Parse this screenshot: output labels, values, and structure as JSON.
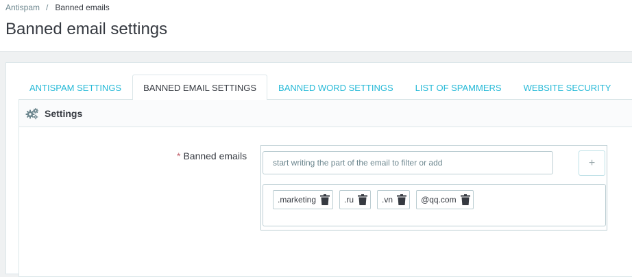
{
  "breadcrumb": {
    "parent": "Antispam",
    "separator": "/",
    "current": "Banned emails"
  },
  "page_title": "Banned email settings",
  "tabs": [
    {
      "label": "ANTISPAM SETTINGS",
      "active": false
    },
    {
      "label": "BANNED EMAIL SETTINGS",
      "active": true
    },
    {
      "label": "BANNED WORD SETTINGS",
      "active": false
    },
    {
      "label": "LIST OF SPAMMERS",
      "active": false
    },
    {
      "label": "WEBSITE SECURITY",
      "active": false
    }
  ],
  "panel": {
    "icon": "gears-icon",
    "title": "Settings"
  },
  "form": {
    "required_mark": "*",
    "label": "Banned emails",
    "input_value": "",
    "input_placeholder": "start writing the part of the email to filter or add",
    "add_label": "+",
    "tags": [
      {
        "label": ".marketing",
        "icon": "trash-icon"
      },
      {
        "label": ".ru",
        "icon": "trash-icon"
      },
      {
        "label": ".vn",
        "icon": "trash-icon"
      },
      {
        "label": "@qq.com",
        "icon": "trash-icon"
      }
    ]
  },
  "colors": {
    "link": "#25b9d7",
    "text": "#363a41",
    "required": "#c05c67",
    "border": "#bbcdd2",
    "background": "#eff1f2"
  }
}
